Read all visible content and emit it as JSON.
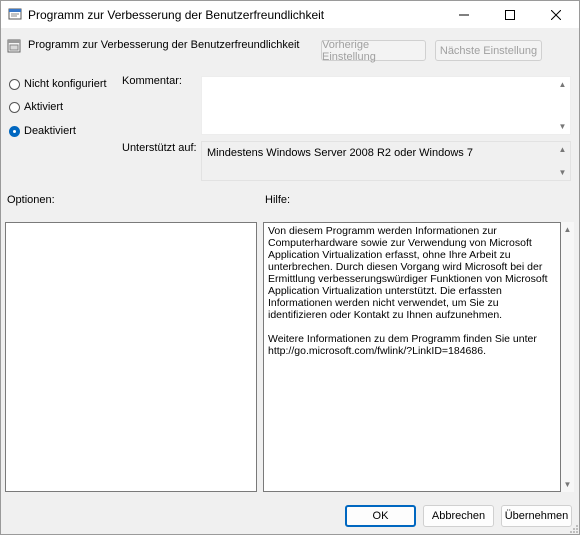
{
  "window": {
    "title": "Programm zur Verbesserung der Benutzerfreundlichkeit"
  },
  "header": {
    "policy_title": "Programm zur Verbesserung der Benutzerfreundlichkeit",
    "prev_label": "Vorherige Einstellung",
    "next_label": "Nächste Einstellung"
  },
  "state": {
    "options": [
      {
        "label": "Nicht konfiguriert",
        "checked": false
      },
      {
        "label": "Aktiviert",
        "checked": false
      },
      {
        "label": "Deaktiviert",
        "checked": true
      }
    ]
  },
  "comment": {
    "label": "Kommentar:",
    "value": ""
  },
  "supported": {
    "label": "Unterstützt auf:",
    "value": "Mindestens Windows Server 2008 R2 oder Windows 7"
  },
  "panels": {
    "options_label": "Optionen:",
    "help_label": "Hilfe:",
    "help_text": "Von diesem Programm werden Informationen zur Computerhardware sowie zur Verwendung von Microsoft Application Virtualization erfasst, ohne Ihre Arbeit zu unterbrechen. Durch diesen Vorgang wird Microsoft bei der Ermittlung verbesserungswürdiger Funktionen von Microsoft Application Virtualization unterstützt. Die erfassten Informationen werden nicht verwendet, um Sie zu identifizieren oder Kontakt zu Ihnen aufzunehmen.\n\nWeitere Informationen zu dem Programm finden Sie unter http://go.microsoft.com/fwlink/?LinkID=184686."
  },
  "footer": {
    "ok_label": "OK",
    "cancel_label": "Abbrechen",
    "apply_label": "Übernehmen"
  }
}
